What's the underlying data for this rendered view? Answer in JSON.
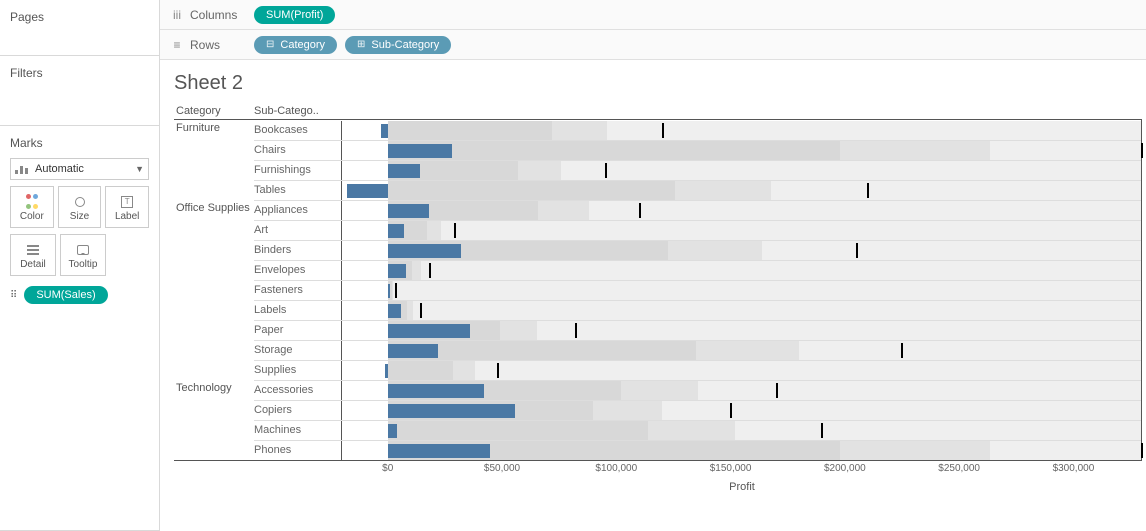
{
  "left": {
    "pages_label": "Pages",
    "filters_label": "Filters",
    "marks_label": "Marks",
    "marks_type": "Automatic",
    "buttons": {
      "color": "Color",
      "size": "Size",
      "label": "Label",
      "detail": "Detail",
      "tooltip": "Tooltip"
    },
    "detail_pill": "SUM(Sales)"
  },
  "shelves": {
    "columns_label": "Columns",
    "rows_label": "Rows",
    "columns_pill": "SUM(Profit)",
    "rows_pill_1": "Category",
    "rows_pill_2": "Sub-Category"
  },
  "sheet": {
    "title": "Sheet 2",
    "category_header": "Category",
    "subcategory_header": "Sub-Catego..",
    "axis_title": "Profit",
    "axis_range": [
      -20000,
      330000
    ],
    "axis_ticks": [
      {
        "v": 0,
        "label": "$0"
      },
      {
        "v": 50000,
        "label": "$50,000"
      },
      {
        "v": 100000,
        "label": "$100,000"
      },
      {
        "v": 150000,
        "label": "$150,000"
      },
      {
        "v": 200000,
        "label": "$200,000"
      },
      {
        "v": 250000,
        "label": "$250,000"
      },
      {
        "v": 300000,
        "label": "$300,000"
      }
    ]
  },
  "chart_data": {
    "type": "bar",
    "title": "Sheet 2",
    "xlabel": "Profit",
    "xlim": [
      -20000,
      330000
    ],
    "notes": "Blue bar = SUM(Profit). Grey bands = 60% and 80% of SUM(Sales) reference. Black tick = SUM(Sales) target (100%).",
    "categories": [
      {
        "name": "Furniture",
        "subs": [
          {
            "name": "Bookcases",
            "profit": -3000,
            "sales": 120000
          },
          {
            "name": "Chairs",
            "profit": 28000,
            "sales": 330000
          },
          {
            "name": "Furnishings",
            "profit": 14000,
            "sales": 95000
          },
          {
            "name": "Tables",
            "profit": -18000,
            "sales": 210000
          }
        ]
      },
      {
        "name": "Office Supplies",
        "subs": [
          {
            "name": "Appliances",
            "profit": 18000,
            "sales": 110000
          },
          {
            "name": "Art",
            "profit": 7000,
            "sales": 29000
          },
          {
            "name": "Binders",
            "profit": 32000,
            "sales": 205000
          },
          {
            "name": "Envelopes",
            "profit": 8000,
            "sales": 18000
          },
          {
            "name": "Fasteners",
            "profit": 1000,
            "sales": 3000
          },
          {
            "name": "Labels",
            "profit": 6000,
            "sales": 14000
          },
          {
            "name": "Paper",
            "profit": 36000,
            "sales": 82000
          },
          {
            "name": "Storage",
            "profit": 22000,
            "sales": 225000
          },
          {
            "name": "Supplies",
            "profit": -1000,
            "sales": 48000
          }
        ]
      },
      {
        "name": "Technology",
        "subs": [
          {
            "name": "Accessories",
            "profit": 42000,
            "sales": 170000
          },
          {
            "name": "Copiers",
            "profit": 56000,
            "sales": 150000
          },
          {
            "name": "Machines",
            "profit": 4000,
            "sales": 190000
          },
          {
            "name": "Phones",
            "profit": 45000,
            "sales": 330000
          }
        ]
      }
    ]
  }
}
